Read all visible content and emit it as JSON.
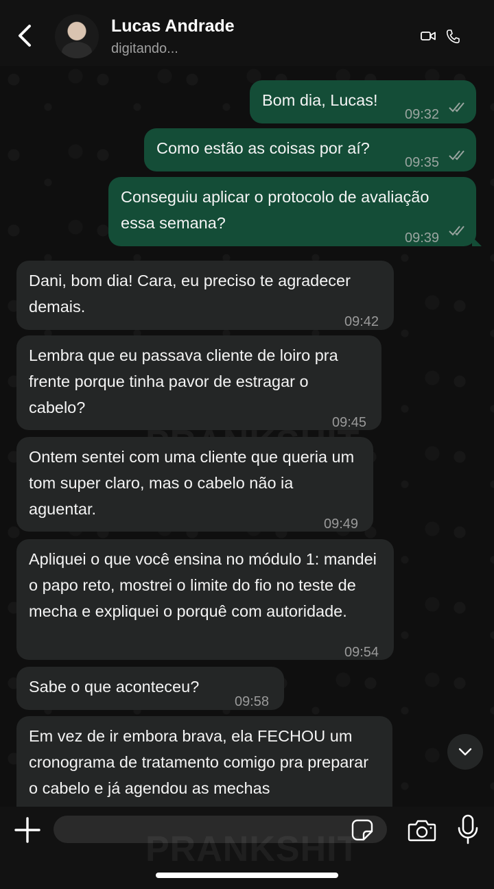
{
  "header": {
    "contact_name": "Lucas Andrade",
    "status": "digitando...",
    "icons": [
      "back-icon",
      "avatar",
      "video-call-icon",
      "phone-call-icon"
    ]
  },
  "watermark": "PRANKSHIT",
  "messages": [
    {
      "direction": "out",
      "text": "Bom dia, Lucas!",
      "time": "09:32",
      "read": true
    },
    {
      "direction": "out",
      "text": "Como estão as coisas por aí?",
      "time": "09:35",
      "read": true
    },
    {
      "direction": "out",
      "text": "Conseguiu aplicar o protocolo de avaliação essa semana?",
      "time": "09:39",
      "read": true
    },
    {
      "direction": "in",
      "text": "Dani, bom dia! Cara, eu preciso te agradecer demais.",
      "time": "09:42"
    },
    {
      "direction": "in",
      "text": "Lembra que eu passava cliente de loiro pra frente porque tinha pavor de estragar o cabelo?",
      "time": "09:45"
    },
    {
      "direction": "in",
      "text": "Ontem sentei com uma cliente que queria um tom super claro, mas o cabelo não ia aguentar.",
      "time": "09:49"
    },
    {
      "direction": "in",
      "text": "Apliquei o que você ensina no módulo 1: mandei o papo reto, mostrei o limite do fio no teste de mecha e expliquei o porquê com autoridade.",
      "time": "09:54"
    },
    {
      "direction": "in",
      "text": "Sabe o que aconteceu?",
      "time": "09:58"
    },
    {
      "direction": "in",
      "text": "Em vez de ir embora brava, ela FECHOU um cronograma de tratamento comigo pra preparar o cabelo e já agendou as mechas",
      "time": ""
    }
  ],
  "composer": {
    "placeholder": "",
    "icons": [
      "plus-icon",
      "sticker-icon",
      "camera-icon",
      "microphone-icon"
    ]
  },
  "colors": {
    "outgoing_bubble": "#144d37",
    "incoming_bubble": "#242626",
    "background": "#0f0f0f",
    "bars": "#121212"
  }
}
